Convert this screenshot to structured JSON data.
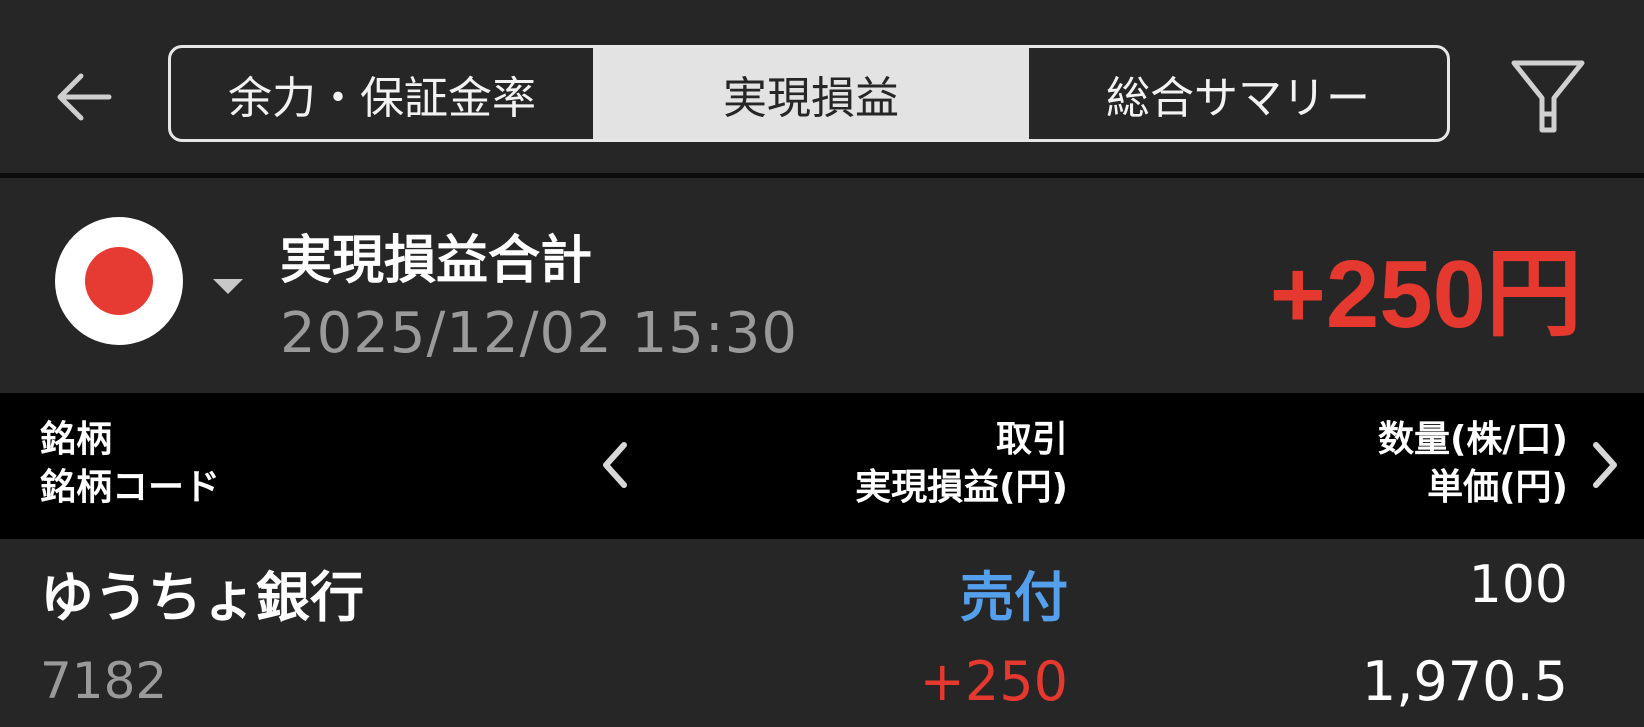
{
  "header": {
    "back_icon": "arrow-left-icon",
    "tabs": [
      {
        "label": "余力・保証金率",
        "selected": false
      },
      {
        "label": "実現損益",
        "selected": true
      },
      {
        "label": "総合サマリー",
        "selected": false
      }
    ],
    "filter_icon": "filter-icon"
  },
  "summary": {
    "market_icon": "japan-flag-icon",
    "title": "実現損益合計",
    "datetime": "2025/12/02  15:30",
    "total": "+250円"
  },
  "table": {
    "columns": [
      {
        "line1": "銘柄",
        "line2": "銘柄コード"
      },
      {
        "line1": "取引",
        "line2": "実現損益(円)"
      },
      {
        "line1": "数量(株/口)",
        "line2": "単価(円)"
      }
    ],
    "rows": [
      {
        "name": "ゆうちょ銀行",
        "code": "7182",
        "trade": "売付",
        "profit_loss": "+250",
        "quantity": "100",
        "unit_price": "1,970.5"
      }
    ]
  },
  "colors": {
    "background": "#262626",
    "header_bg": "#000000",
    "profit_red": "#e5392f",
    "sell_blue": "#55a0ec",
    "selected_tab_bg": "#e3e3e3"
  }
}
